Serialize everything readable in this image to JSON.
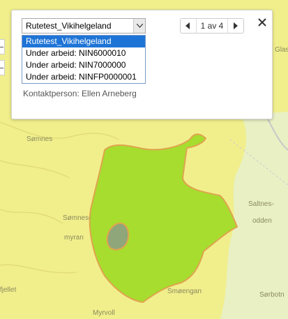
{
  "popup": {
    "select": {
      "selected": "Rutetest_Vikihelgeland",
      "options": [
        "Rutetest_Vikihelgeland",
        "Under arbeid: NIN6000010",
        "Under arbeid: NIN7000000",
        "Under arbeid: NINFP0000001"
      ]
    },
    "contact": "Kontaktperson: Ellen Arneberg",
    "pager": {
      "text": "1 av 4"
    }
  },
  "map": {
    "labels": [
      "Glas",
      "Sømnes",
      "Sømnes-",
      "myran",
      "Saltnes-",
      "odden",
      "Smøengan",
      "Myrvoll",
      "fjellet",
      "Sørbotn"
    ]
  },
  "colors": {
    "map_bg": "#f1ef8c",
    "polygon_fill": "#a6dd2e",
    "polygon_border": "#e0a44f",
    "inner_patch": "#8fa67a",
    "right_land": "#e7f0c1",
    "select_highlight": "#1e74d6"
  }
}
